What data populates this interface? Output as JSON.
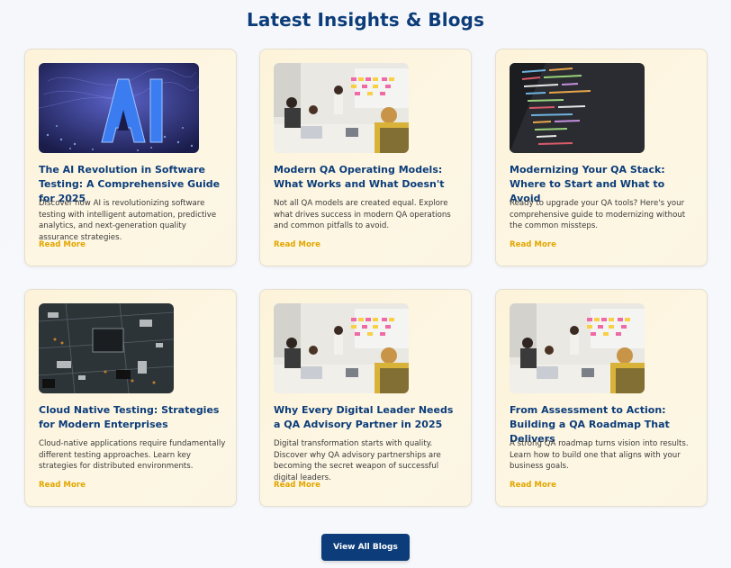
{
  "section": {
    "title": "Latest Insights & Blogs"
  },
  "cards": [
    {
      "image": "ai-hologram-image",
      "title": "The AI Revolution in Software Testing: A Comprehensive Guide for 2025",
      "description": "Discover how AI is revolutionizing software testing with intelligent automation, predictive analytics, and next-generation quality assurance strategies.",
      "link": "Read More"
    },
    {
      "image": "team-meeting-image",
      "title": "Modern QA Operating Models: What Works and What Doesn't",
      "description": "Not all QA models are created equal. Explore what drives success in modern QA operations and common pitfalls to avoid.",
      "link": "Read More"
    },
    {
      "image": "code-screen-image",
      "title": "Modernizing Your QA Stack: Where to Start and What to Avoid",
      "description": "Ready to upgrade your QA tools? Here's your comprehensive guide to modernizing without the common missteps.",
      "link": "Read More"
    },
    {
      "image": "circuit-board-image",
      "title": "Cloud Native Testing: Strategies for Modern Enterprises",
      "description": "Cloud-native applications require fundamentally different testing approaches. Learn key strategies for distributed environments.",
      "link": "Read More"
    },
    {
      "image": "team-meeting-image",
      "title": "Why Every Digital Leader Needs a QA Advisory Partner in 2025",
      "description": "Digital transformation starts with quality. Discover why QA advisory partnerships are becoming the secret weapon of successful digital leaders.",
      "link": "Read More"
    },
    {
      "image": "team-meeting-image",
      "title": "From Assessment to Action: Building a QA Roadmap That Delivers",
      "description": "A strong QA roadmap turns vision into results. Learn how to build one that aligns with your business goals.",
      "link": "Read More"
    }
  ],
  "footer": {
    "view_all_label": "View All Blogs"
  },
  "colors": {
    "accent": "#0c3d7a",
    "link": "#e2a600",
    "card_bg": "#fdf3da"
  }
}
